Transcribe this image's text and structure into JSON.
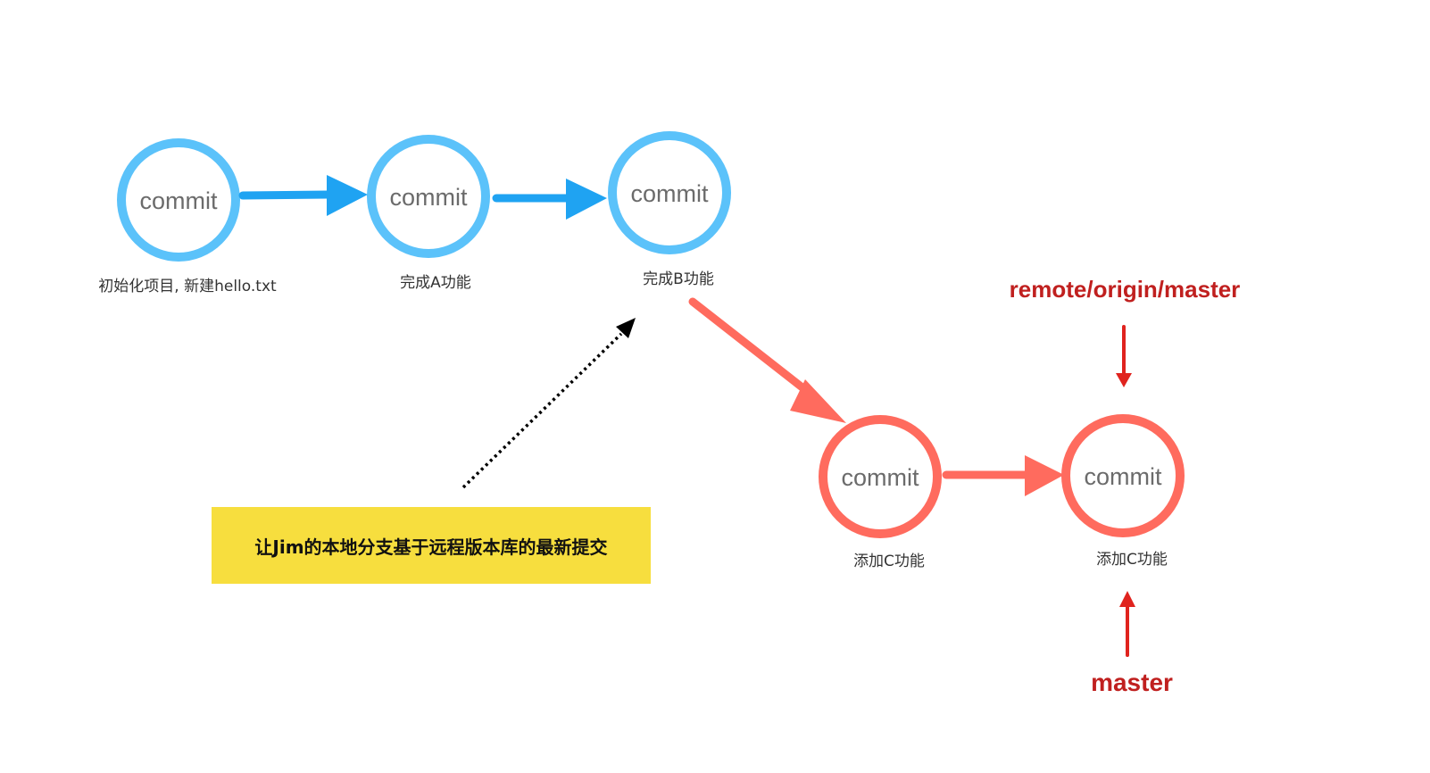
{
  "colors": {
    "blue_node": "#5bc2fa",
    "blue_arrow": "#1fa3f2",
    "red_node": "#ff6b5e",
    "pointer": "#e0231e",
    "pointer_label": "#c0201f",
    "note_bg": "#f7de3e",
    "dotted_arrow": "#000000"
  },
  "commits": [
    {
      "label": "commit",
      "caption": "初始化项目, 新建hello.txt",
      "color": "blue"
    },
    {
      "label": "commit",
      "caption": "完成A功能",
      "color": "blue"
    },
    {
      "label": "commit",
      "caption": "完成B功能",
      "color": "blue"
    },
    {
      "label": "commit",
      "caption": "添加C功能",
      "color": "red"
    },
    {
      "label": "commit",
      "caption": "添加C功能",
      "color": "red"
    }
  ],
  "pointers": {
    "remote": "remote/origin/master",
    "local": "master"
  },
  "note": {
    "text": "让Jim的本地分支基于远程版本库的最新提交"
  }
}
